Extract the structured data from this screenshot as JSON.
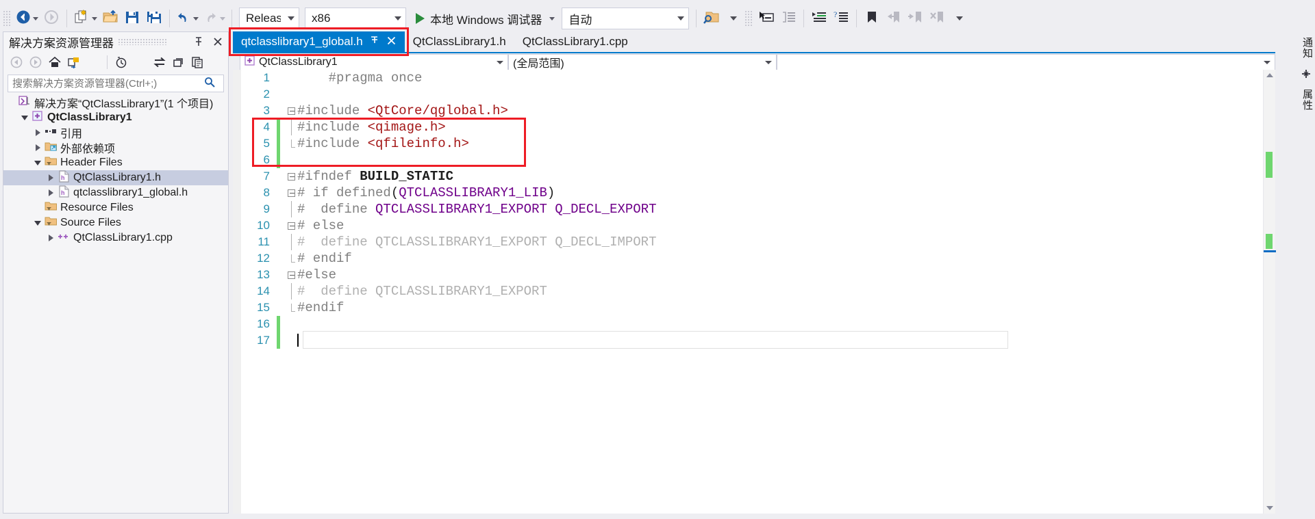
{
  "toolbar": {
    "buttons": [
      {
        "name": "navigate-backward",
        "icon": "back-arrow-icon"
      },
      {
        "name": "navigate-forward",
        "icon": "forward-arrow-icon"
      },
      {
        "name": "new-item",
        "icon": "new-file-icon"
      },
      {
        "name": "open-file",
        "icon": "open-folder-icon"
      },
      {
        "name": "save",
        "icon": "save-icon"
      },
      {
        "name": "save-all",
        "icon": "save-all-icon"
      },
      {
        "name": "undo",
        "icon": "undo-arrow-icon"
      },
      {
        "name": "redo",
        "icon": "redo-arrow-icon"
      }
    ],
    "configuration": "Release",
    "platform": "x86",
    "run_label": "本地 Windows 调试器",
    "attach_target": "自动",
    "right_buttons": [
      {
        "name": "find-in-files",
        "icon": "search-folder-icon"
      },
      {
        "name": "toggle-window",
        "icon": "window-icon"
      },
      {
        "name": "comment-selection",
        "icon": "comment-icon"
      },
      {
        "name": "increase-indent",
        "icon": "indent-icon"
      },
      {
        "name": "outdent",
        "icon": "outdent-icon"
      },
      {
        "name": "toggle-bookmark",
        "icon": "bookmark-icon"
      },
      {
        "name": "previous-bookmark",
        "icon": "bookmark-prev-icon"
      },
      {
        "name": "next-bookmark",
        "icon": "bookmark-next-icon"
      },
      {
        "name": "clear-bookmarks",
        "icon": "bookmark-clear-icon"
      }
    ]
  },
  "solution_explorer": {
    "title": "解决方案资源管理器",
    "search_placeholder": "搜索解决方案资源管理器(Ctrl+;)",
    "toolbar": [
      {
        "name": "back",
        "icon": "back-arrow-icon"
      },
      {
        "name": "forward",
        "icon": "forward-arrow-icon"
      },
      {
        "name": "home",
        "icon": "home-icon"
      },
      {
        "name": "pending-changes",
        "icon": "solution-switch-icon"
      },
      {
        "name": "show-history",
        "icon": "clock-icon"
      },
      {
        "name": "sync-with-active-document",
        "icon": "sync-arrows-icon"
      },
      {
        "name": "refresh",
        "icon": "refresh-icon"
      },
      {
        "name": "show-all-files",
        "icon": "copy-pages-icon"
      }
    ],
    "tree": [
      {
        "label": "解决方案“QtClassLibrary1”(1 个项目)",
        "depth": 0,
        "twisty": "none",
        "icon": "solution-icon",
        "bold": false,
        "selected": false
      },
      {
        "label": "QtClassLibrary1",
        "depth": 1,
        "twisty": "down",
        "icon": "project-icon",
        "bold": true,
        "selected": false
      },
      {
        "label": "引用",
        "depth": 2,
        "twisty": "right",
        "icon": "references-icon",
        "bold": false,
        "selected": false
      },
      {
        "label": "外部依赖项",
        "depth": 2,
        "twisty": "right",
        "icon": "external-deps-icon",
        "bold": false,
        "selected": false
      },
      {
        "label": "Header Files",
        "depth": 2,
        "twisty": "down",
        "icon": "filter-folder-icon",
        "bold": false,
        "selected": false
      },
      {
        "label": "QtClassLibrary1.h",
        "depth": 3,
        "twisty": "right",
        "icon": "header-file-icon",
        "bold": false,
        "selected": true
      },
      {
        "label": "qtclasslibrary1_global.h",
        "depth": 3,
        "twisty": "right",
        "icon": "header-file-icon",
        "bold": false,
        "selected": false
      },
      {
        "label": "Resource Files",
        "depth": 2,
        "twisty": "none",
        "icon": "filter-folder-icon",
        "bold": false,
        "selected": false
      },
      {
        "label": "Source Files",
        "depth": 2,
        "twisty": "down",
        "icon": "filter-folder-icon",
        "bold": false,
        "selected": false
      },
      {
        "label": "QtClassLibrary1.cpp",
        "depth": 3,
        "twisty": "right",
        "icon": "cpp-file-icon",
        "bold": false,
        "selected": false
      }
    ]
  },
  "editor": {
    "tabs": [
      {
        "label": "qtclasslibrary1_global.h",
        "active": true,
        "pinnable": true,
        "closable": true
      },
      {
        "label": "QtClassLibrary1.h",
        "active": false,
        "pinnable": false,
        "closable": false
      },
      {
        "label": "QtClassLibrary1.cpp",
        "active": false,
        "pinnable": false,
        "closable": false
      }
    ],
    "navbar": {
      "project": "QtClassLibrary1",
      "scope": "(全局范围)",
      "member": ""
    },
    "code_lines": [
      {
        "n": 1,
        "fold": "none",
        "changed": false,
        "segments": [
          {
            "t": "    ",
            "c": "plain"
          },
          {
            "t": "#pragma once",
            "c": "pre"
          }
        ]
      },
      {
        "n": 2,
        "fold": "none",
        "changed": false,
        "segments": []
      },
      {
        "n": 3,
        "fold": "open",
        "changed": false,
        "segments": [
          {
            "t": "#include ",
            "c": "pre"
          },
          {
            "t": "<QtCore/qglobal.h>",
            "c": "str"
          }
        ]
      },
      {
        "n": 4,
        "fold": "line",
        "changed": true,
        "segments": [
          {
            "t": "#include ",
            "c": "pre"
          },
          {
            "t": "<qimage.h>",
            "c": "str"
          }
        ]
      },
      {
        "n": 5,
        "fold": "end",
        "changed": true,
        "segments": [
          {
            "t": "#include ",
            "c": "pre"
          },
          {
            "t": "<qfileinfo.h>",
            "c": "str"
          }
        ]
      },
      {
        "n": 6,
        "fold": "none",
        "changed": true,
        "segments": []
      },
      {
        "n": 7,
        "fold": "open",
        "changed": false,
        "segments": [
          {
            "t": "#ifndef ",
            "c": "pre"
          },
          {
            "t": "BUILD_STATIC",
            "c": "plain-bold"
          }
        ]
      },
      {
        "n": 8,
        "fold": "open",
        "changed": false,
        "segments": [
          {
            "t": "# if defined",
            "c": "pre"
          },
          {
            "t": "(",
            "c": "plain"
          },
          {
            "t": "QTCLASSLIBRARY1_LIB",
            "c": "macro"
          },
          {
            "t": ")",
            "c": "plain"
          }
        ]
      },
      {
        "n": 9,
        "fold": "line",
        "changed": false,
        "segments": [
          {
            "t": "#  define ",
            "c": "pre"
          },
          {
            "t": "QTCLASSLIBRARY1_EXPORT Q_DECL_EXPORT",
            "c": "macro"
          }
        ]
      },
      {
        "n": 10,
        "fold": "open",
        "changed": false,
        "segments": [
          {
            "t": "# else",
            "c": "pre"
          }
        ]
      },
      {
        "n": 11,
        "fold": "line",
        "changed": false,
        "segments": [
          {
            "t": "#  define QTCLASSLIBRARY1_EXPORT Q_DECL_IMPORT",
            "c": "dim"
          }
        ]
      },
      {
        "n": 12,
        "fold": "end",
        "changed": false,
        "segments": [
          {
            "t": "# endif",
            "c": "pre"
          }
        ]
      },
      {
        "n": 13,
        "fold": "open",
        "changed": false,
        "segments": [
          {
            "t": "#else",
            "c": "pre"
          }
        ]
      },
      {
        "n": 14,
        "fold": "line",
        "changed": false,
        "segments": [
          {
            "t": "#  define QTCLASSLIBRARY1_EXPORT",
            "c": "dim"
          }
        ]
      },
      {
        "n": 15,
        "fold": "end",
        "changed": false,
        "segments": [
          {
            "t": "#endif",
            "c": "pre"
          }
        ]
      },
      {
        "n": 16,
        "fold": "none",
        "changed": true,
        "segments": []
      },
      {
        "n": 17,
        "fold": "none",
        "changed": true,
        "segments": [],
        "caret": true
      }
    ]
  },
  "right_panel": {
    "tabs": [
      "通知",
      "属性"
    ],
    "buttons": [
      {
        "name": "toolbox",
        "icon": "toolbox-icon"
      }
    ]
  },
  "colors": {
    "accent": "#007acc",
    "highlight_box": "#ee1c25",
    "changed_marker": "#6fd66f",
    "selection": "#c7cde0",
    "chrome": "#eeeef2",
    "string": "#a31515",
    "macro": "#6f008a",
    "preprocessor": "#808080",
    "line_number": "#2b91af"
  }
}
